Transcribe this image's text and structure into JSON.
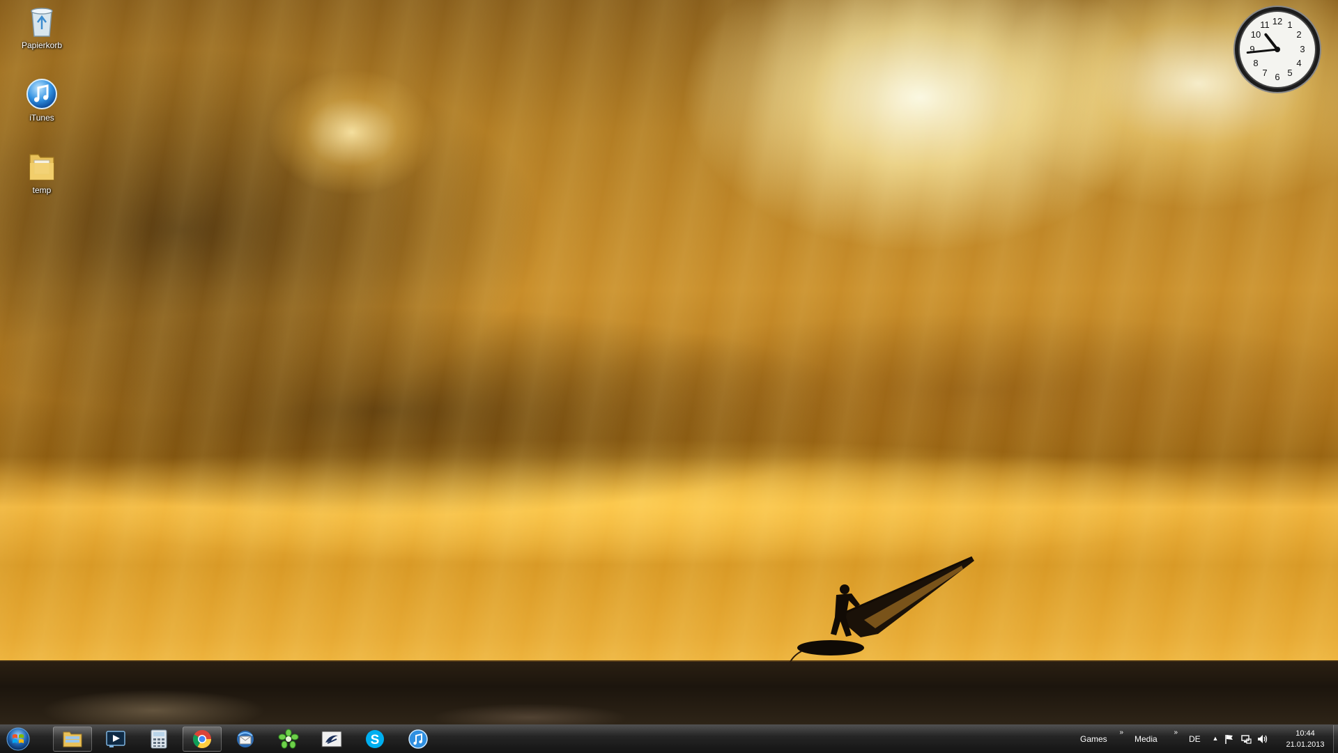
{
  "desktop": {
    "icons": [
      {
        "label": "Papierkorb",
        "icon": "recycle-bin-icon"
      },
      {
        "label": "iTunes",
        "icon": "itunes-icon"
      },
      {
        "label": "temp",
        "icon": "folder-icon"
      }
    ]
  },
  "clock_gadget": {
    "numbers": [
      "12",
      "1",
      "2",
      "3",
      "4",
      "5",
      "6",
      "7",
      "8",
      "9",
      "10",
      "11"
    ],
    "time": "10:44"
  },
  "taskbar": {
    "start": {
      "icon": "windows-logo-icon"
    },
    "pinned": [
      {
        "name": "explorer",
        "icon": "folder-icon",
        "open": true
      },
      {
        "name": "media-player",
        "icon": "play-icon",
        "open": false
      },
      {
        "name": "calculator",
        "icon": "calculator-icon",
        "open": false
      },
      {
        "name": "chrome",
        "icon": "chrome-icon",
        "open": true
      },
      {
        "name": "thunderbird",
        "icon": "mail-client-icon",
        "open": false
      },
      {
        "name": "icq",
        "icon": "flower-icon",
        "open": false
      },
      {
        "name": "teamspeak",
        "icon": "teamspeak-icon",
        "open": false
      },
      {
        "name": "skype",
        "icon": "skype-icon",
        "open": false
      },
      {
        "name": "itunes",
        "icon": "itunes-icon",
        "open": false
      }
    ],
    "toolbars": [
      {
        "label": "Games",
        "chevron": "»"
      },
      {
        "label": "Media",
        "chevron": "»"
      }
    ],
    "tray": {
      "language": "DE",
      "expand_arrow": "▲",
      "time": "10:44",
      "date": "21.01.2013"
    }
  },
  "colors": {
    "sky_gold": "#f0b43c",
    "cloud_dark": "#6a4614",
    "sea_dark": "#1c150d",
    "taskbar": "#1e1e1e"
  }
}
